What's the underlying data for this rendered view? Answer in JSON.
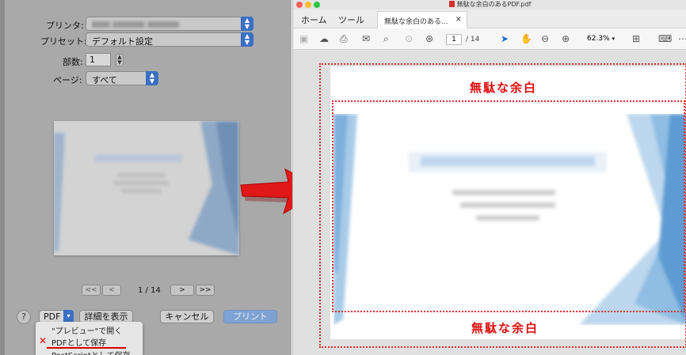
{
  "print_dialog": {
    "printer_label": "プリンタ:",
    "preset_label": "プリセット:",
    "preset_value": "デフォルト設定",
    "copies_label": "部数:",
    "copies_value": "1",
    "pages_label": "ページ:",
    "pages_value": "すべて",
    "page_indicator": "1 / 14",
    "nav": {
      "first": "<<",
      "prev": "<",
      "next": ">",
      "last": ">>"
    },
    "help": "?",
    "pdf_button": "PDF",
    "show_details": "詳細を表示",
    "cancel": "キャンセル",
    "print": "プリント",
    "pdf_menu": {
      "items": [
        "\"プレビュー\"で開く",
        "PDFとして保存",
        "PostScriptとして保存"
      ],
      "marker": "✕"
    }
  },
  "acrobat": {
    "window_title": "無駄な余白のあるPDF.pdf",
    "tabs": {
      "home": "ホーム",
      "tools": "ツール",
      "document": "無駄な余白のある...",
      "close": "×"
    },
    "toolbar": {
      "page_current": "1",
      "page_total": "/ 14",
      "zoom": "62.3%"
    },
    "annotations": {
      "top": "無駄な余白",
      "bottom": "無駄な余白"
    }
  },
  "colors": {
    "annotation_red": "#e01010",
    "accent_blue": "#3b6fc4",
    "toolbar_blue": "#1b6ad8"
  }
}
